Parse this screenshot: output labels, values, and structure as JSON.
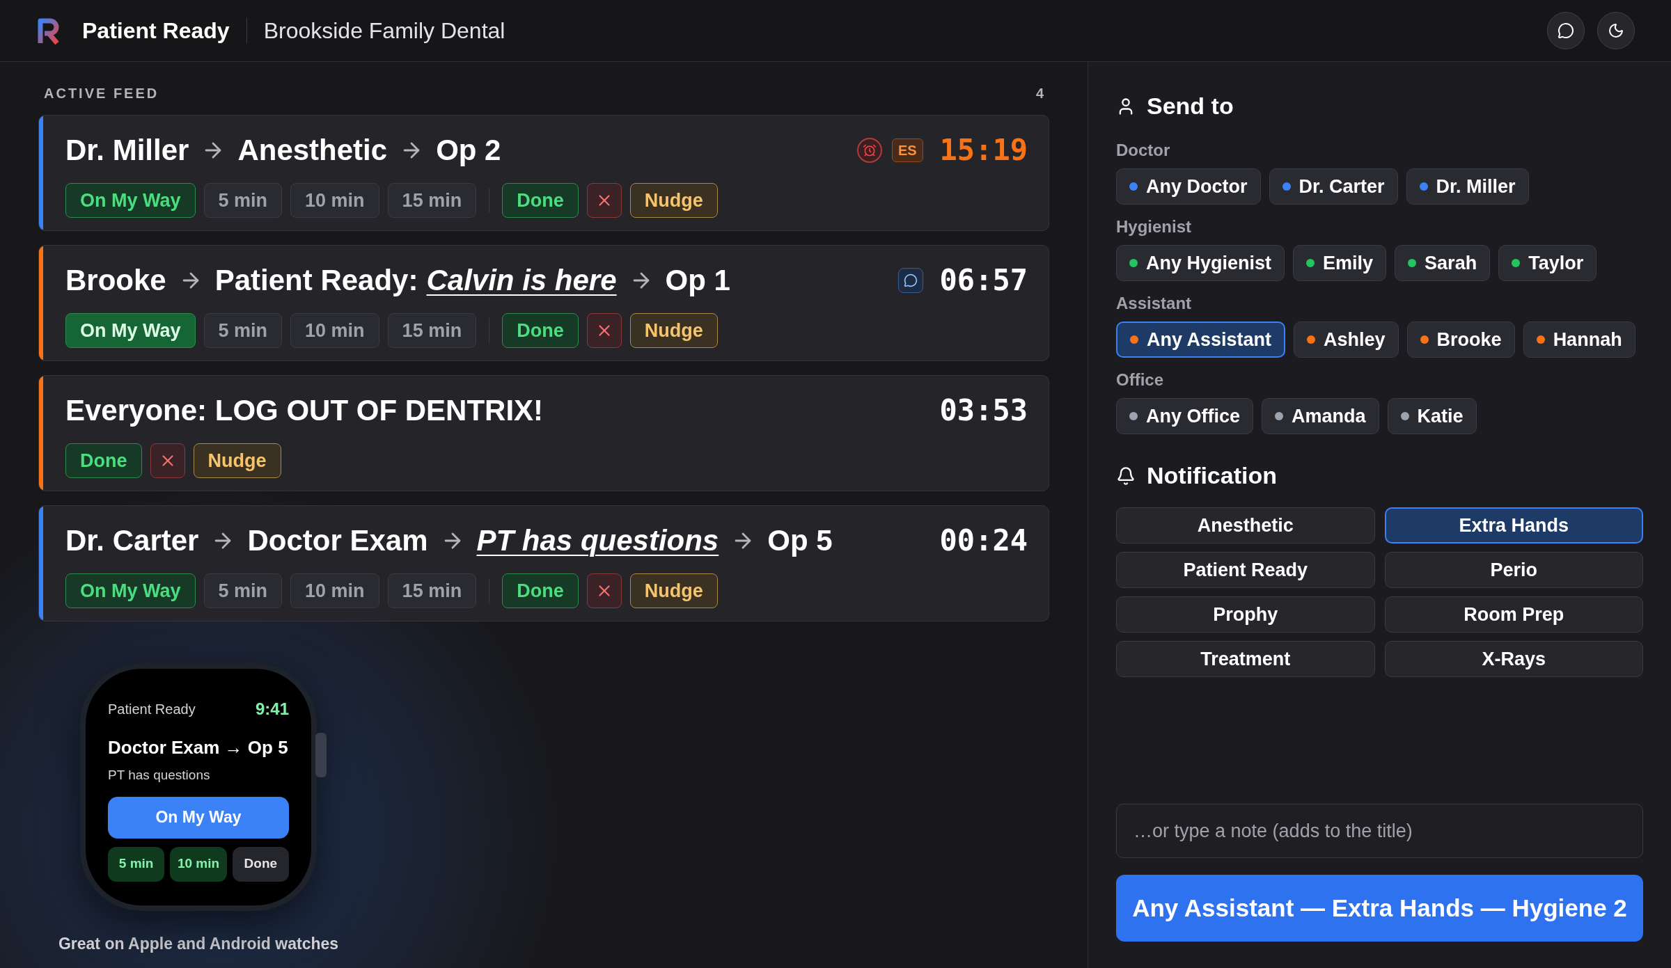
{
  "header": {
    "app_name": "Patient Ready",
    "practice": "Brookside Family Dental"
  },
  "feed": {
    "title": "ACTIVE FEED",
    "count": "4",
    "items": [
      {
        "color": "#3b82f6",
        "overdue": true,
        "alarm": true,
        "message": false,
        "badge": "ES",
        "timer": "15:19",
        "segments": [
          {
            "text": "Dr. Miller",
            "kind": "plain",
            "arrow_before": false
          },
          {
            "text": "Anesthetic",
            "kind": "plain",
            "arrow_before": true
          },
          {
            "text": "Op 2",
            "kind": "plain",
            "arrow_before": true
          }
        ],
        "actions": [
          {
            "kind": "on_my_way",
            "label": "On My Way",
            "selected": false
          },
          {
            "kind": "time",
            "label": "5 min"
          },
          {
            "kind": "time",
            "label": "10 min"
          },
          {
            "kind": "time",
            "label": "15 min"
          },
          {
            "kind": "done",
            "label": "Done"
          },
          {
            "kind": "dismiss"
          },
          {
            "kind": "nudge",
            "label": "Nudge"
          }
        ]
      },
      {
        "color": "#f97316",
        "overdue": false,
        "alarm": false,
        "message": true,
        "timer": "06:57",
        "segments": [
          {
            "text": "Brooke",
            "kind": "plain",
            "arrow_before": false
          },
          {
            "text": "Patient Ready:",
            "kind": "plain",
            "arrow_before": true
          },
          {
            "text": "Calvin is here",
            "kind": "note",
            "arrow_before": false
          },
          {
            "text": "Op 1",
            "kind": "plain",
            "arrow_before": true
          }
        ],
        "actions": [
          {
            "kind": "on_my_way",
            "label": "On My Way",
            "selected": true
          },
          {
            "kind": "time",
            "label": "5 min"
          },
          {
            "kind": "time",
            "label": "10 min"
          },
          {
            "kind": "time",
            "label": "15 min"
          },
          {
            "kind": "done",
            "label": "Done"
          },
          {
            "kind": "dismiss"
          },
          {
            "kind": "nudge",
            "label": "Nudge"
          }
        ]
      },
      {
        "color": "#f97316",
        "overdue": false,
        "alarm": false,
        "message": false,
        "timer": "03:53",
        "segments": [
          {
            "text": "Everyone: LOG OUT OF DENTRIX!",
            "kind": "plain",
            "arrow_before": false
          }
        ],
        "actions": [
          {
            "kind": "done",
            "label": "Done"
          },
          {
            "kind": "dismiss"
          },
          {
            "kind": "nudge",
            "label": "Nudge"
          }
        ]
      },
      {
        "color": "#3b82f6",
        "overdue": false,
        "alarm": false,
        "message": false,
        "timer": "00:24",
        "segments": [
          {
            "text": "Dr. Carter",
            "kind": "plain",
            "arrow_before": false
          },
          {
            "text": "Doctor Exam",
            "kind": "plain",
            "arrow_before": true
          },
          {
            "text": "PT has questions",
            "kind": "note",
            "arrow_before": true
          },
          {
            "text": "Op 5",
            "kind": "plain",
            "arrow_before": true
          }
        ],
        "actions": [
          {
            "kind": "on_my_way",
            "label": "On My Way",
            "selected": false
          },
          {
            "kind": "time",
            "label": "5 min"
          },
          {
            "kind": "time",
            "label": "10 min"
          },
          {
            "kind": "time",
            "label": "15 min"
          },
          {
            "kind": "done",
            "label": "Done"
          },
          {
            "kind": "dismiss"
          },
          {
            "kind": "nudge",
            "label": "Nudge"
          }
        ]
      }
    ]
  },
  "watch": {
    "app": "Patient Ready",
    "time": "9:41",
    "title": "Doctor Exam → Op 5",
    "subtitle": "PT has questions",
    "primary": "On My Way",
    "buttons": [
      {
        "kind": "time",
        "label": "5 min"
      },
      {
        "kind": "time",
        "label": "10 min"
      },
      {
        "kind": "done",
        "label": "Done"
      }
    ],
    "caption": "Great on Apple and Android watches"
  },
  "send_to": {
    "title": "Send to",
    "groups": [
      {
        "label": "Doctor",
        "options": [
          {
            "label": "Any Doctor",
            "color": "#3b82f6",
            "selected": false
          },
          {
            "label": "Dr. Carter",
            "color": "#3b82f6",
            "selected": false
          },
          {
            "label": "Dr. Miller",
            "color": "#3b82f6",
            "selected": false
          }
        ]
      },
      {
        "label": "Hygienist",
        "options": [
          {
            "label": "Any Hygienist",
            "color": "#22c55e",
            "selected": false
          },
          {
            "label": "Emily",
            "color": "#22c55e",
            "selected": false
          },
          {
            "label": "Sarah",
            "color": "#22c55e",
            "selected": false
          },
          {
            "label": "Taylor",
            "color": "#22c55e",
            "selected": false
          }
        ]
      },
      {
        "label": "Assistant",
        "options": [
          {
            "label": "Any Assistant",
            "color": "#f97316",
            "selected": true
          },
          {
            "label": "Ashley",
            "color": "#f97316",
            "selected": false
          },
          {
            "label": "Brooke",
            "color": "#f97316",
            "selected": false
          },
          {
            "label": "Hannah",
            "color": "#f97316",
            "selected": false
          }
        ]
      },
      {
        "label": "Office",
        "options": [
          {
            "label": "Any Office",
            "color": "#9ca3af",
            "selected": false
          },
          {
            "label": "Amanda",
            "color": "#9ca3af",
            "selected": false
          },
          {
            "label": "Katie",
            "color": "#9ca3af",
            "selected": false
          }
        ]
      }
    ]
  },
  "notification": {
    "title": "Notification",
    "options": [
      {
        "label": "Anesthetic",
        "selected": false
      },
      {
        "label": "Extra Hands",
        "selected": true
      },
      {
        "label": "Patient Ready",
        "selected": false
      },
      {
        "label": "Perio",
        "selected": false
      },
      {
        "label": "Prophy",
        "selected": false
      },
      {
        "label": "Room Prep",
        "selected": false
      },
      {
        "label": "Treatment",
        "selected": false
      },
      {
        "label": "X-Rays",
        "selected": false
      }
    ]
  },
  "note": {
    "placeholder": "…or type a note (adds to the title)"
  },
  "send_button": {
    "label": "Any Assistant — Extra Hands — Hygiene 2"
  }
}
